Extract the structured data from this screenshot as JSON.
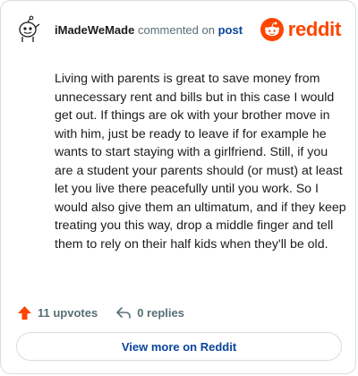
{
  "header": {
    "username": "iMadeWeMade",
    "commented_text": "commented on",
    "post_link": "post",
    "brand_word": "reddit",
    "brand_color": "#ff4500",
    "avatar_icon": "snoo-avatar-icon",
    "brand_icon": "reddit-logo-icon"
  },
  "comment": {
    "body": "Living with parents is great to save money from unnecessary rent and bills but in this case I would get out. If things are ok with your brother move in with him, just be ready to leave if for example he wants to start staying with a girlfriend. Still, if you are a student your parents should (or must) at least let you live there peacefully until you work. So I would also give them an ultimatum, and if they keep treating you this way, drop a middle finger and tell them to rely on their half kids when they'll be old."
  },
  "actions": {
    "upvotes_label": "11 upvotes",
    "upvote_color": "#ff4500",
    "replies_label": "0 replies",
    "upvote_icon": "upvote-arrow-icon",
    "reply_icon": "reply-arrow-icon"
  },
  "footer": {
    "view_more_label": "View more on Reddit",
    "link_color": "#0a449b"
  }
}
